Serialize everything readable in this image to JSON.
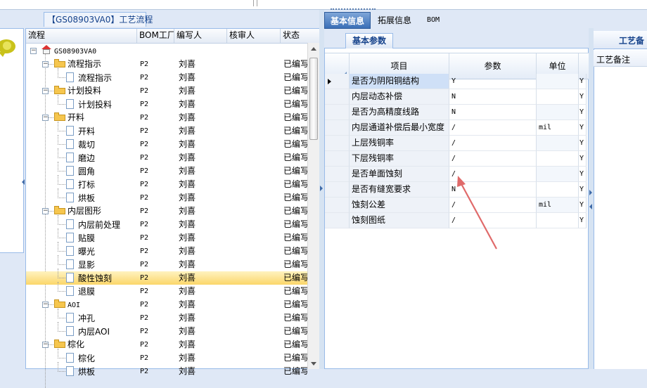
{
  "flow_tab": {
    "label": "【GS08903VA0】工艺流程"
  },
  "tree": {
    "columns": [
      "流程",
      "BOM工厂",
      "编写人",
      "核审人",
      "状态"
    ],
    "rows": [
      {
        "name": "GS08903VA0",
        "level": 0,
        "kind": "root",
        "bom": "",
        "writer": "",
        "reviewer": "",
        "status": ""
      },
      {
        "name": "流程指示",
        "level": 1,
        "kind": "folder",
        "bom": "P2",
        "writer": "刘喜",
        "reviewer": "",
        "status": "已编写"
      },
      {
        "name": "流程指示",
        "level": 2,
        "kind": "doc",
        "bom": "P2",
        "writer": "刘喜",
        "reviewer": "",
        "status": "已编写"
      },
      {
        "name": "计划投料",
        "level": 1,
        "kind": "folder",
        "bom": "P2",
        "writer": "刘喜",
        "reviewer": "",
        "status": "已编写"
      },
      {
        "name": "计划投料",
        "level": 2,
        "kind": "doc",
        "bom": "P2",
        "writer": "刘喜",
        "reviewer": "",
        "status": "已编写"
      },
      {
        "name": "开料",
        "level": 1,
        "kind": "folder",
        "bom": "P2",
        "writer": "刘喜",
        "reviewer": "",
        "status": "已编写"
      },
      {
        "name": "开料",
        "level": 2,
        "kind": "doc",
        "bom": "P2",
        "writer": "刘喜",
        "reviewer": "",
        "status": "已编写"
      },
      {
        "name": "裁切",
        "level": 2,
        "kind": "doc",
        "bom": "P2",
        "writer": "刘喜",
        "reviewer": "",
        "status": "已编写"
      },
      {
        "name": "磨边",
        "level": 2,
        "kind": "doc",
        "bom": "P2",
        "writer": "刘喜",
        "reviewer": "",
        "status": "已编写"
      },
      {
        "name": "圆角",
        "level": 2,
        "kind": "doc",
        "bom": "P2",
        "writer": "刘喜",
        "reviewer": "",
        "status": "已编写"
      },
      {
        "name": "打标",
        "level": 2,
        "kind": "doc",
        "bom": "P2",
        "writer": "刘喜",
        "reviewer": "",
        "status": "已编写"
      },
      {
        "name": "烘板",
        "level": 2,
        "kind": "doc",
        "bom": "P2",
        "writer": "刘喜",
        "reviewer": "",
        "status": "已编写"
      },
      {
        "name": "内层图形",
        "level": 1,
        "kind": "folder",
        "bom": "P2",
        "writer": "刘喜",
        "reviewer": "",
        "status": "已编写"
      },
      {
        "name": "内层前处理",
        "level": 2,
        "kind": "doc",
        "bom": "P2",
        "writer": "刘喜",
        "reviewer": "",
        "status": "已编写"
      },
      {
        "name": "贴膜",
        "level": 2,
        "kind": "doc",
        "bom": "P2",
        "writer": "刘喜",
        "reviewer": "",
        "status": "已编写"
      },
      {
        "name": "曝光",
        "level": 2,
        "kind": "doc",
        "bom": "P2",
        "writer": "刘喜",
        "reviewer": "",
        "status": "已编写"
      },
      {
        "name": "显影",
        "level": 2,
        "kind": "doc",
        "bom": "P2",
        "writer": "刘喜",
        "reviewer": "",
        "status": "已编写"
      },
      {
        "name": "酸性蚀刻",
        "level": 2,
        "kind": "doc",
        "bom": "P2",
        "writer": "刘喜",
        "reviewer": "",
        "status": "已编写",
        "selected": true
      },
      {
        "name": "退膜",
        "level": 2,
        "kind": "doc",
        "bom": "P2",
        "writer": "刘喜",
        "reviewer": "",
        "status": "已编写"
      },
      {
        "name": "AOI",
        "level": 1,
        "kind": "folder",
        "bom": "P2",
        "writer": "刘喜",
        "reviewer": "",
        "status": "已编写"
      },
      {
        "name": "冲孔",
        "level": 2,
        "kind": "doc",
        "bom": "P2",
        "writer": "刘喜",
        "reviewer": "",
        "status": "已编写"
      },
      {
        "name": "内层AOI",
        "level": 2,
        "kind": "doc",
        "bom": "P2",
        "writer": "刘喜",
        "reviewer": "",
        "status": "已编写"
      },
      {
        "name": "棕化",
        "level": 1,
        "kind": "folder",
        "bom": "P2",
        "writer": "刘喜",
        "reviewer": "",
        "status": "已编写"
      },
      {
        "name": "棕化",
        "level": 2,
        "kind": "doc",
        "bom": "P2",
        "writer": "刘喜",
        "reviewer": "",
        "status": "已编写"
      },
      {
        "name": "烘板",
        "level": 2,
        "kind": "doc",
        "bom": "P2",
        "writer": "刘喜",
        "reviewer": "",
        "status": "已编写"
      }
    ]
  },
  "tabs": [
    "基本信息",
    "拓展信息",
    "BOM"
  ],
  "subtab": "基本参数",
  "params": {
    "columns": [
      "项目",
      "参数",
      "单位"
    ],
    "rows": [
      {
        "item": "是否为阴阳铜结构",
        "value": "Y",
        "unit": "",
        "flag": "Y"
      },
      {
        "item": "内层动态补偿",
        "value": "N",
        "unit": "",
        "flag": "Y"
      },
      {
        "item": "是否为高精度线路",
        "value": "N",
        "unit": "",
        "flag": "Y"
      },
      {
        "item": "内层通道补偿后最小宽度",
        "value": "/",
        "unit": "mil",
        "flag": "Y"
      },
      {
        "item": "上层残铜率",
        "value": "/",
        "unit": "",
        "flag": "Y"
      },
      {
        "item": "下层残铜率",
        "value": "/",
        "unit": "",
        "flag": "Y"
      },
      {
        "item": "是否单面蚀刻",
        "value": "/",
        "unit": "",
        "flag": "Y"
      },
      {
        "item": "是否有缝宽要求",
        "value": "N",
        "unit": "",
        "flag": "Y"
      },
      {
        "item": "蚀刻公差",
        "value": "/",
        "unit": "mil",
        "flag": "Y"
      },
      {
        "item": "蚀刻图纸",
        "value": "/",
        "unit": "",
        "flag": "Y"
      }
    ]
  },
  "right_panel": {
    "title": "工艺备",
    "subtitle": "工艺备注"
  },
  "colors": {
    "accent": "#3a6fb7",
    "selection": "#fbd66a",
    "annotation_arrow": "#e06a6a"
  }
}
